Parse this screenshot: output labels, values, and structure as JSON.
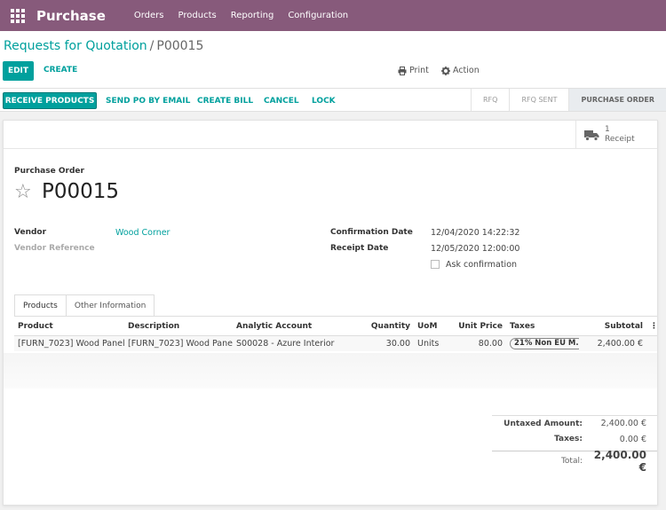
{
  "nav": {
    "app_name": "Purchase",
    "menu": [
      "Orders",
      "Products",
      "Reporting",
      "Configuration"
    ]
  },
  "breadcrumb": {
    "parent": "Requests for Quotation",
    "separator": "/",
    "current": "P00015"
  },
  "toolbar": {
    "edit_label": "EDIT",
    "create_label": "CREATE",
    "print_label": "Print",
    "action_label": "Action"
  },
  "statusbar": {
    "buttons": [
      "RECEIVE PRODUCTS",
      "SEND PO BY EMAIL",
      "CREATE BILL",
      "CANCEL",
      "LOCK"
    ],
    "stages": [
      "RFQ",
      "RFQ SENT",
      "PURCHASE ORDER"
    ],
    "active_stage": "PURCHASE ORDER"
  },
  "smart_button": {
    "count": "1",
    "label": "Receipt"
  },
  "form": {
    "doc_type": "Purchase Order",
    "name": "P00015",
    "vendor_label": "Vendor",
    "vendor_value": "Wood Corner",
    "vendor_ref_label": "Vendor Reference",
    "confirmation_label": "Confirmation Date",
    "confirmation_value": "12/04/2020 14:22:32",
    "receipt_label": "Receipt Date",
    "receipt_value": "12/05/2020 12:00:00",
    "ask_confirmation_label": "Ask confirmation"
  },
  "tabs": [
    "Products",
    "Other Information"
  ],
  "table": {
    "headers": [
      "Product",
      "Description",
      "Analytic Account",
      "Quantity",
      "UoM",
      "Unit Price",
      "Taxes",
      "Subtotal"
    ],
    "rows": [
      {
        "product": "[FURN_7023] Wood Panel",
        "description": "[FURN_7023] Wood Panel",
        "analytic": "S00028 - Azure Interior",
        "quantity": "30.00",
        "uom": "Units",
        "unit_price": "80.00",
        "tax": "21% Non EU M.",
        "subtotal": "2,400.00 €"
      }
    ]
  },
  "totals": {
    "untaxed_label": "Untaxed Amount:",
    "untaxed_value": "2,400.00 €",
    "taxes_label": "Taxes:",
    "taxes_value": "0.00 €",
    "total_label": "Total:",
    "total_value": "2,400.00 €"
  },
  "colors": {
    "brand": "#875a7b",
    "accent": "#00a09d"
  }
}
